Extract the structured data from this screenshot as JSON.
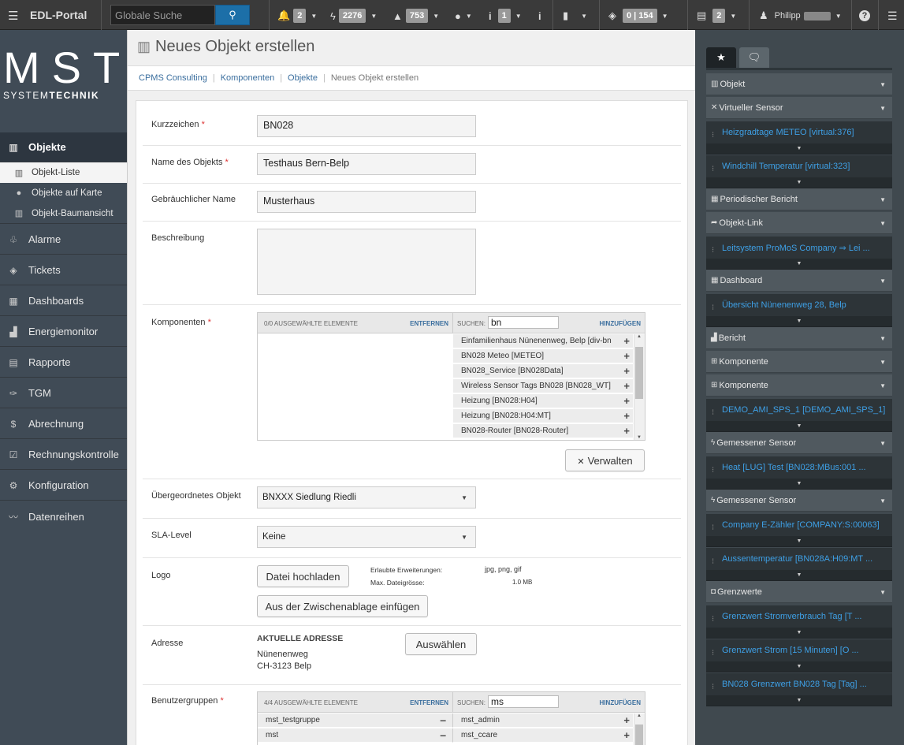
{
  "topbar": {
    "brand": "EDL-Portal",
    "search_placeholder": "Globale Suche",
    "alarms_count": "2",
    "events_count": "2276",
    "warnings_count": "753",
    "info_count": "1",
    "tickets_count": "0 | 154",
    "reports_count": "2",
    "user_name": "Philipp"
  },
  "logo": {
    "line1": "MST",
    "line2_a": "SYSTEM",
    "line2_b": "TECHNIK"
  },
  "sidebar": {
    "items": [
      {
        "label": "Objekte",
        "icon": "building-icon"
      },
      {
        "label": "Alarme",
        "icon": "bell-icon"
      },
      {
        "label": "Tickets",
        "icon": "tag-icon"
      },
      {
        "label": "Dashboards",
        "icon": "grid-icon"
      },
      {
        "label": "Energiemonitor",
        "icon": "bar-chart-icon"
      },
      {
        "label": "Rapporte",
        "icon": "document-icon"
      },
      {
        "label": "TGM",
        "icon": "wrench-icon"
      },
      {
        "label": "Abrechnung",
        "icon": "dollar-icon"
      },
      {
        "label": "Rechnungskontrolle",
        "icon": "checkbox-icon"
      },
      {
        "label": "Konfiguration",
        "icon": "gears-icon"
      },
      {
        "label": "Datenreihen",
        "icon": "line-chart-icon"
      }
    ],
    "subitems": [
      {
        "label": "Objekt-Liste",
        "icon": "building-icon"
      },
      {
        "label": "Objekte auf Karte",
        "icon": "globe-icon"
      },
      {
        "label": "Objekt-Baumansicht",
        "icon": "building-icon"
      }
    ]
  },
  "page": {
    "title": "Neues Objekt erstellen",
    "breadcrumb": [
      "CPMS Consulting",
      "Komponenten",
      "Objekte",
      "Neues Objekt erstellen"
    ]
  },
  "form": {
    "kurzzeichen": {
      "label": "Kurzzeichen",
      "value": "BN028"
    },
    "name": {
      "label": "Name des Objekts",
      "value": "Testhaus Bern-Belp"
    },
    "gebrauch": {
      "label": "Gebräuchlicher Name",
      "value": "Musterhaus"
    },
    "beschreibung": {
      "label": "Beschreibung",
      "value": ""
    },
    "komponenten": {
      "label": "Komponenten",
      "selected_header": "0/0 AUSGEWÄHLTE ELEMENTE",
      "remove_label": "ENTFERNEN",
      "search_label": "SUCHEN:",
      "search_value": "bn",
      "add_label": "HINZUFÜGEN",
      "available": [
        "Einfamilienhaus Nünenenweg, Belp [div-bn",
        "BN028 Meteo [METEO]",
        "BN028_Service [BN028Data]",
        "Wireless Sensor Tags BN028 [BN028_WT]",
        "Heizung [BN028:H04]",
        "Heizung [BN028:H04:MT]",
        "BN028-Router [BN028-Router]"
      ],
      "manage_button": "Verwalten"
    },
    "parent": {
      "label": "Übergeordnetes Objekt",
      "value": "BNXXX Siedlung Riedli"
    },
    "sla": {
      "label": "SLA-Level",
      "value": "Keine"
    },
    "logo": {
      "label": "Logo",
      "upload_button": "Datei hochladen",
      "paste_button": "Aus der Zwischenablage einfügen",
      "ext_label": "Erlaubte Erweiterungen:",
      "ext_value": "jpg, png, gif",
      "size_label": "Max. Dateigrösse:",
      "size_value": "1.0 MB"
    },
    "address": {
      "label": "Adresse",
      "heading": "AKTUELLE ADRESSE",
      "street": "Nünenenweg",
      "city": "CH-3123 Belp",
      "select_button": "Auswählen"
    },
    "groups": {
      "label": "Benutzergruppen",
      "selected_header": "4/4 AUSGEWÄHLTE ELEMENTE",
      "remove_label": "ENTFERNEN",
      "search_label": "SUCHEN:",
      "search_value": "ms",
      "add_label": "HINZUFÜGEN",
      "selected": [
        "mst_testgruppe",
        "mst"
      ],
      "available": [
        "mst_admin",
        "mst_ccare"
      ]
    }
  },
  "right_panel": {
    "sections": [
      {
        "type": "head",
        "label": "Objekt",
        "icon": "building-icon"
      },
      {
        "type": "head",
        "label": "Virtueller Sensor",
        "icon": "tools-icon"
      },
      {
        "type": "item",
        "label": "Heizgradtage METEO [virtual:376]"
      },
      {
        "type": "item",
        "label": "Windchill Temperatur [virtual:323]"
      },
      {
        "type": "head",
        "label": "Periodischer Bericht",
        "icon": "table-icon"
      },
      {
        "type": "head",
        "label": "Objekt-Link",
        "icon": "share-icon"
      },
      {
        "type": "item",
        "label": "Leitsystem ProMoS Company ⇒ Lei ..."
      },
      {
        "type": "head",
        "label": "Dashboard",
        "icon": "grid-icon"
      },
      {
        "type": "item",
        "label": "Übersicht Nünenenweg 28, Belp"
      },
      {
        "type": "head",
        "label": "Bericht",
        "icon": "bar-chart-icon"
      },
      {
        "type": "head",
        "label": "Komponente",
        "icon": "sitemap-icon"
      },
      {
        "type": "head",
        "label": "Komponente",
        "icon": "sitemap-icon"
      },
      {
        "type": "item",
        "label": "DEMO_AMI_SPS_1 [DEMO_AMI_SPS_1]"
      },
      {
        "type": "head",
        "label": "Gemessener Sensor",
        "icon": "bolt-icon"
      },
      {
        "type": "item",
        "label": "Heat [LUG] Test [BN028:MBus:001 ..."
      },
      {
        "type": "head",
        "label": "Gemessener Sensor",
        "icon": "bolt-icon"
      },
      {
        "type": "item",
        "label": "Company E-Zähler [COMPANY:S:00063]"
      },
      {
        "type": "item",
        "label": "Aussentemperatur [BN028A:H09:MT ..."
      },
      {
        "type": "head",
        "label": "Grenzwerte",
        "icon": "gauge-icon"
      },
      {
        "type": "item",
        "label": "Grenzwert Stromverbrauch Tag [T ..."
      },
      {
        "type": "item",
        "label": "Grenzwert Strom [15 Minuten] [O ..."
      },
      {
        "type": "item",
        "label": "BN028 Grenzwert BN028 Tag [Tag] ..."
      }
    ]
  }
}
